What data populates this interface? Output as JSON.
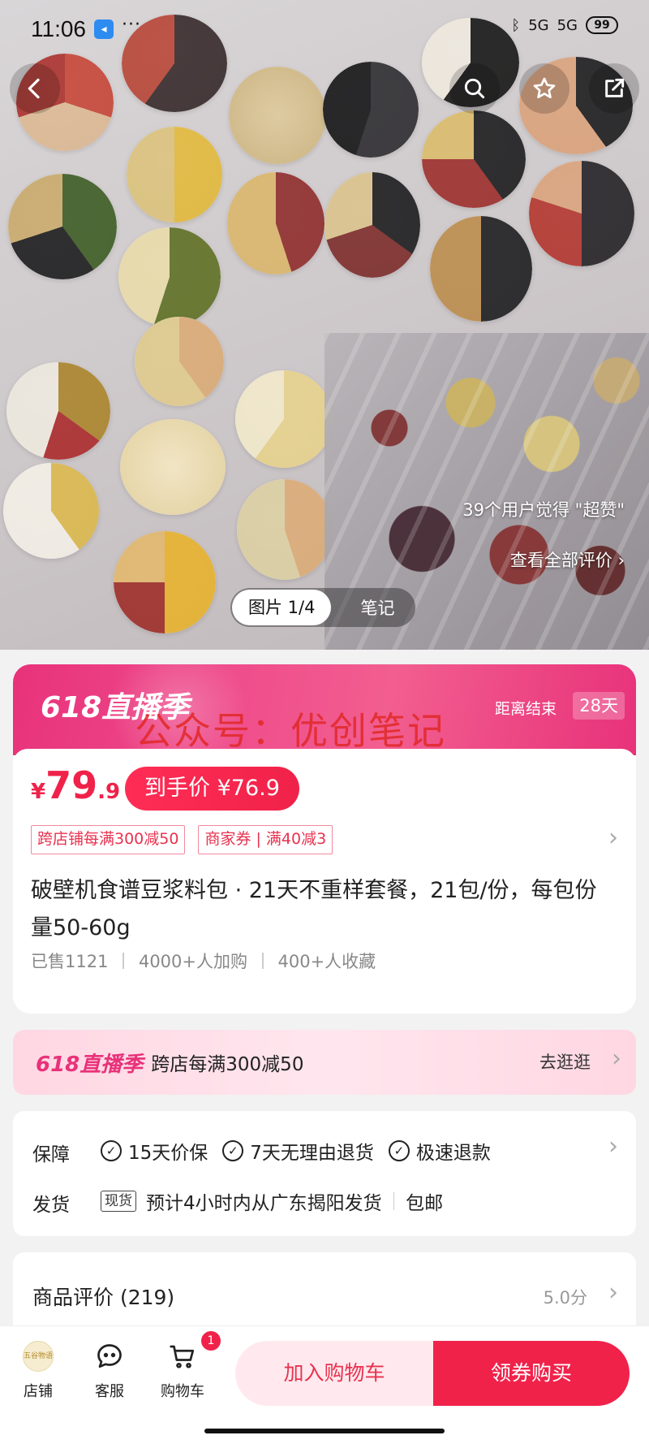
{
  "status_bar": {
    "time": "11:06",
    "app_badge": "◂",
    "overflow": "···",
    "network_1": "5G",
    "network_2": "5G",
    "battery": "99"
  },
  "gallery": {
    "review_hint": "39个用户觉得 \"超赞\"",
    "review_link": "查看全部评价 ›",
    "tab_active": "图片 1/4",
    "tab_notes": "笔记"
  },
  "promo": {
    "logo": "618直播季",
    "countdown_label": "距离结束",
    "countdown_value": "28天",
    "watermark": "公众号：优创笔记"
  },
  "product": {
    "currency": "¥",
    "price_int": "79",
    "price_dec": ".9",
    "final_price": "到手价 ¥76.9",
    "coupons": [
      "跨店铺每满300减50",
      "商家券 | 满40减3"
    ],
    "title": "破壁机食谱豆浆料包 · 21天不重样套餐，21包/份，每包份量50-60g",
    "sold": "已售1121",
    "added": "4000+人加购",
    "favorited": "400+人收藏"
  },
  "live_bar": {
    "logo": "618直播季",
    "text": "跨店每满300减50",
    "action": "去逛逛"
  },
  "guarantee": {
    "label": "保障",
    "items": [
      "15天价保",
      "7天无理由退货",
      "极速退款"
    ],
    "shipping_label": "发货",
    "stock_tag": "现货",
    "shipping_text": "预计4小时内从广东揭阳发货",
    "shipping_free": "包邮"
  },
  "reviews": {
    "title": "商品评价 (219)",
    "score": "5.0分"
  },
  "bottom_bar": {
    "store_logo_text": "五谷物语",
    "store_label": "店铺",
    "service_label": "客服",
    "cart_label": "购物车",
    "cart_count": "1",
    "add_cart": "加入购物车",
    "buy": "领券购买"
  },
  "colors": {
    "accent": "#f0224a",
    "promo_pink": "#e8327a"
  }
}
